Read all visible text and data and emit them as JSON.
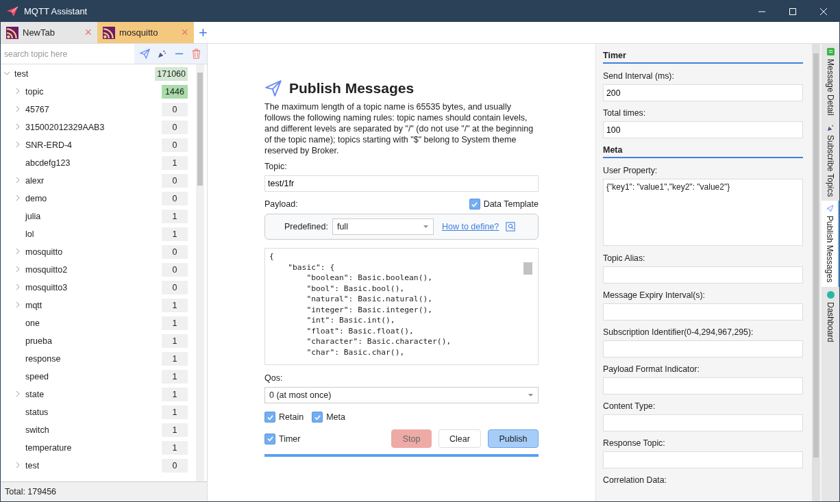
{
  "window": {
    "title": "MQTT Assistant"
  },
  "tabs": [
    {
      "label": "NewTab",
      "selected": false,
      "close": "×"
    },
    {
      "label": "mosquitto",
      "selected": true,
      "close": "×"
    }
  ],
  "add_tab": "+",
  "sidebar": {
    "search": {
      "placeholder": "search topic here"
    },
    "tree": [
      {
        "name": "test",
        "count": "171060",
        "color": "#d3e7d3",
        "expanded": true,
        "children": [
          {
            "name": "topic",
            "count": "1446",
            "color": "#a9dcaa",
            "expanded": false
          },
          {
            "name": "45767",
            "count": "0",
            "color": "#f0f0f0",
            "expanded": false
          },
          {
            "name": "315002012329AAB3",
            "count": "0",
            "color": "#f0f0f0",
            "expanded": false
          },
          {
            "name": "SNR-ERD-4",
            "count": "0",
            "color": "#f0f0f0",
            "expanded": false
          },
          {
            "name": "abcdefg123",
            "count": "1",
            "color": "#f0f0f0"
          },
          {
            "name": "alexr",
            "count": "0",
            "color": "#f0f0f0",
            "expanded": false
          },
          {
            "name": "demo",
            "count": "0",
            "color": "#f0f0f0",
            "expanded": false
          },
          {
            "name": "julia",
            "count": "1",
            "color": "#f0f0f0"
          },
          {
            "name": "lol",
            "count": "1",
            "color": "#f0f0f0"
          },
          {
            "name": "mosquitto",
            "count": "0",
            "color": "#f0f0f0",
            "expanded": false
          },
          {
            "name": "mosquitto2",
            "count": "0",
            "color": "#f0f0f0",
            "expanded": false
          },
          {
            "name": "mosquitto3",
            "count": "0",
            "color": "#f0f0f0",
            "expanded": false
          },
          {
            "name": "mqtt",
            "count": "1",
            "color": "#f0f0f0",
            "expanded": false
          },
          {
            "name": "one",
            "count": "1",
            "color": "#f0f0f0"
          },
          {
            "name": "prueba",
            "count": "1",
            "color": "#f0f0f0"
          },
          {
            "name": "response",
            "count": "1",
            "color": "#f0f0f0"
          },
          {
            "name": "speed",
            "count": "1",
            "color": "#f0f0f0"
          },
          {
            "name": "state",
            "count": "1",
            "color": "#f0f0f0",
            "expanded": false
          },
          {
            "name": "status",
            "count": "1",
            "color": "#f0f0f0"
          },
          {
            "name": "switch",
            "count": "1",
            "color": "#f0f0f0"
          },
          {
            "name": "temperature",
            "count": "1",
            "color": "#f0f0f0"
          },
          {
            "name": "test",
            "count": "0",
            "color": "#f0f0f0",
            "expanded": false
          }
        ]
      }
    ],
    "status": "Total: 179456"
  },
  "publish": {
    "title": "Publish Messages",
    "description": "The maximum length of a topic name is 65535 bytes, and usually follows the following naming rules: topic names should contain levels, and different levels are separated by \"/\" (do not use \"/\" at the beginning of the topic name); topics starting with \"$\" belong to System theme reserved by Broker.",
    "topic_label": "Topic:",
    "topic": "test/1fr",
    "payload_label": "Payload:",
    "data_template": {
      "label": "Data Template",
      "checked": true
    },
    "predefined_label": "Predefined:",
    "predefined": "full",
    "how_to": "How to define?",
    "payload_lines": [
      "{",
      "    \"basic\": {",
      "        \"boolean\": Basic.boolean(),",
      "        \"bool\": Basic.bool(),",
      "        \"natural\": Basic.natural(),",
      "        \"integer\": Basic.integer(),",
      "        \"int\": Basic.int(),",
      "        \"float\": Basic.float(),",
      "        \"character\": Basic.character(),",
      "        \"char\": Basic.char(),"
    ],
    "qos_label": "Qos:",
    "qos": "0 (at most once)",
    "options": [
      {
        "label": "Retain",
        "checked": true
      },
      {
        "label": "Meta",
        "checked": true
      }
    ],
    "timer": {
      "label": "Timer",
      "checked": true
    },
    "buttons": [
      {
        "label": "Stop",
        "kind": "stop",
        "disabled": true
      },
      {
        "label": "Clear",
        "kind": "plain",
        "disabled": false
      },
      {
        "label": "Publish",
        "kind": "primary",
        "disabled": false
      }
    ]
  },
  "settings": {
    "sections": [
      {
        "title": "Timer",
        "fields": [
          {
            "label": "Send Interval (ms):",
            "value": "200",
            "kind": "input"
          },
          {
            "label": "Total times:",
            "value": "100",
            "kind": "input"
          }
        ]
      },
      {
        "title": "Meta",
        "fields": [
          {
            "label": "User Property:",
            "value": "{\"key1\": \"value1\",\"key2\": \"value2\"}",
            "kind": "textarea"
          },
          {
            "label": "Topic Alias:",
            "kind": "input"
          },
          {
            "label": "Message Expiry Interval(s):",
            "kind": "input"
          },
          {
            "label": "Subscription Identifier(0-4,294,967,295):",
            "kind": "input"
          },
          {
            "label": "Payload Format Indicator:",
            "kind": "input"
          },
          {
            "label": "Content Type:",
            "kind": "input"
          },
          {
            "label": "Response Topic:",
            "kind": "input"
          },
          {
            "label": "Correlation Data:",
            "kind": "label"
          }
        ]
      }
    ]
  },
  "side_tabs": [
    {
      "label": "Message Detail",
      "selected": false,
      "kind": "detail"
    },
    {
      "label": "Subscribe Topics",
      "selected": false,
      "kind": "subscribe"
    },
    {
      "label": "Publish Messages",
      "selected": true,
      "kind": "publish"
    },
    {
      "label": "Dashboard",
      "selected": false,
      "kind": "dashboard"
    }
  ]
}
